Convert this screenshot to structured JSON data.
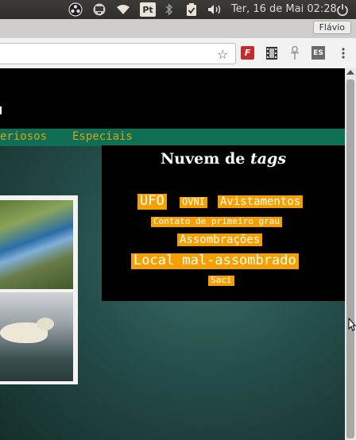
{
  "system_panel": {
    "clock": "Ter, 16 de Mai 02:28",
    "icons": [
      "obs-studio-icon",
      "monitor-icon",
      "wifi-icon",
      "pt-keyboard-icon",
      "bluetooth-icon",
      "clipboard-check-icon",
      "volume-icon",
      "power-icon"
    ],
    "keyboard_layout": "Pt"
  },
  "browser": {
    "profile_name": "Flávio",
    "bookmark_star": "☆",
    "extensions": [
      "ext-red-f-icon",
      "film-strip-icon",
      "ankh-icon",
      "es-icon",
      "menu-icon"
    ]
  },
  "nav": {
    "items": [
      {
        "label": "eriosos"
      },
      {
        "label": "Especiais"
      }
    ]
  },
  "tag_cloud": {
    "title_prefix": "Nuvem de",
    "title_emph": "tags",
    "tags": [
      {
        "label": "UFO"
      },
      {
        "label": "OVNI"
      },
      {
        "label": "Avistamentos"
      },
      {
        "label": "Contato de primeiro grau"
      },
      {
        "label": "Assombrações"
      },
      {
        "label": "Local mal-assombrado"
      },
      {
        "label": "Saci"
      }
    ]
  },
  "colors": {
    "tag_bg": "#f5a000",
    "nav_bg": "#0f6f55",
    "nav_text": "#d4a414"
  }
}
